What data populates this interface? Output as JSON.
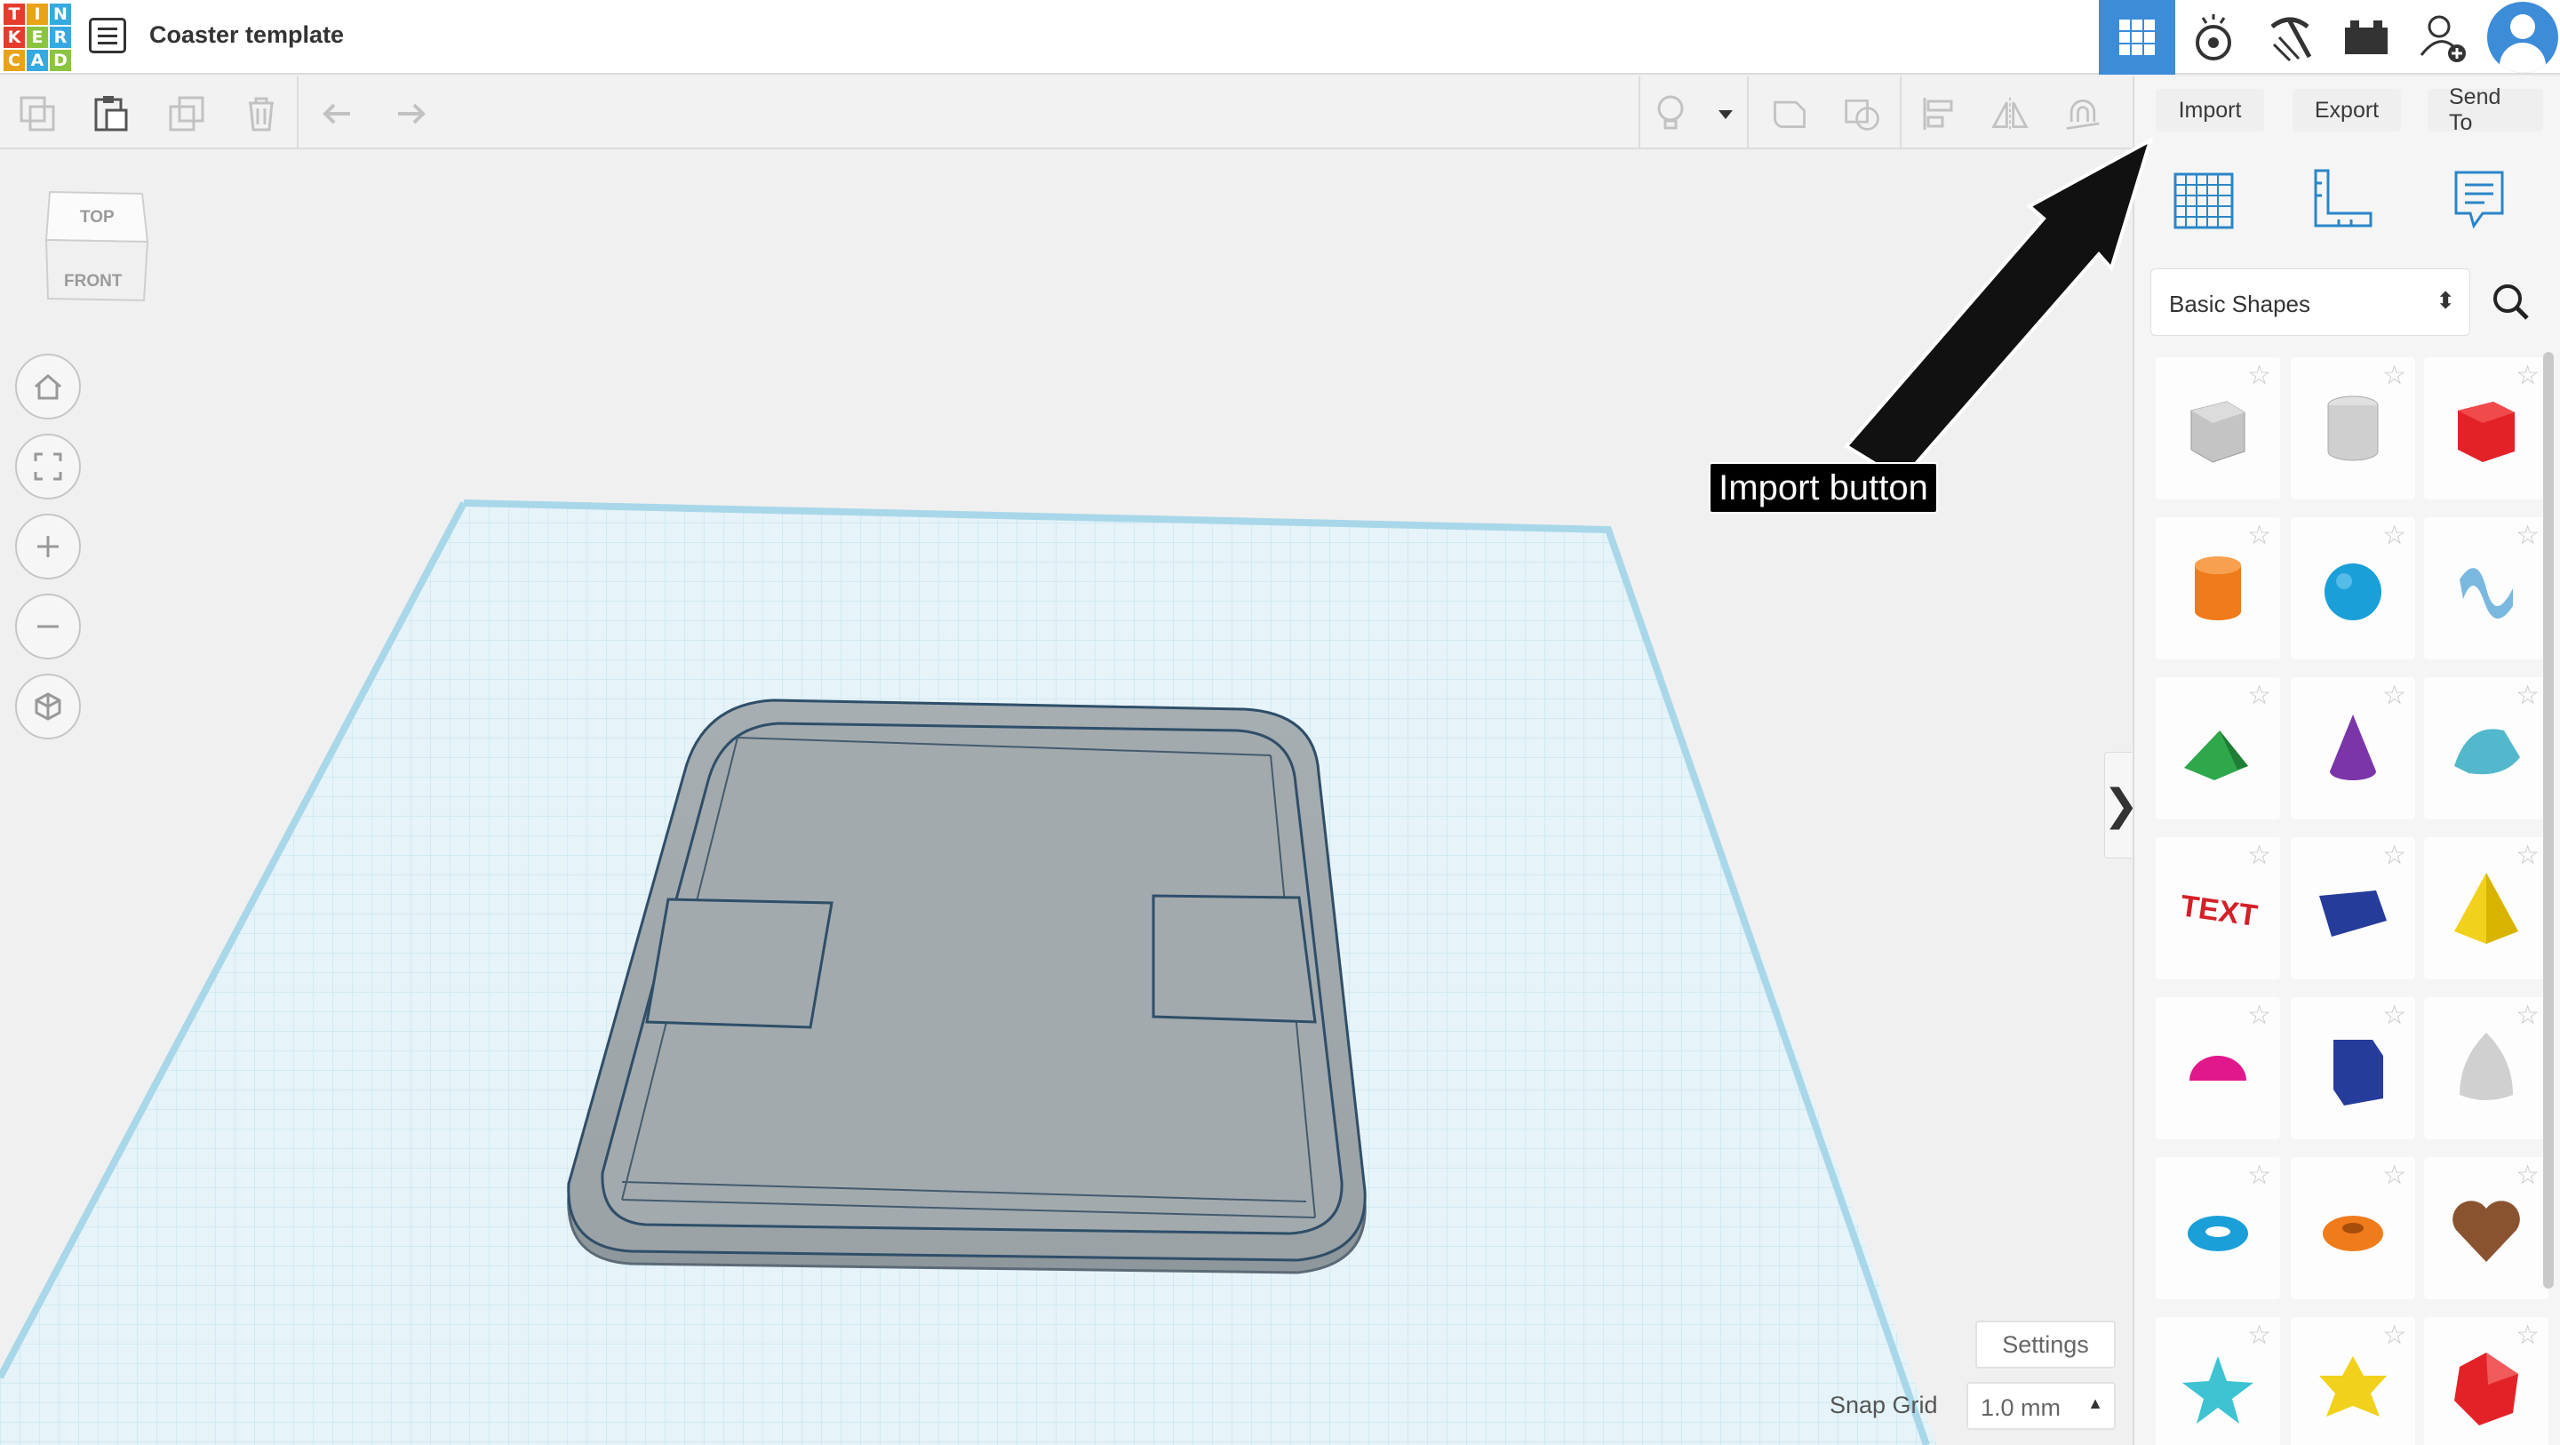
{
  "app": {
    "logo_letters": [
      "T",
      "I",
      "N",
      "K",
      "E",
      "R",
      "C",
      "A",
      "D"
    ],
    "logo_colors": [
      "#e53c2e",
      "#e8a317",
      "#36a9e1",
      "#e53c2e",
      "#8bc53f",
      "#36a9e1",
      "#e8a317",
      "#36a9e1",
      "#8bc53f"
    ],
    "document_title": "Coaster template",
    "accent_color": "#3c8cd8"
  },
  "header_icons": [
    "3d-design-grid-icon",
    "circuits-icon",
    "blocks-pickaxe-icon",
    "bricks-icon",
    "add-user-icon",
    "user-avatar-icon"
  ],
  "toolbar": {
    "icons": [
      "copy-icon",
      "paste-icon",
      "duplicate-icon",
      "delete-icon",
      "undo-icon",
      "redo-icon",
      "light-bulb-icon",
      "dropdown-icon",
      "group-icon",
      "ungroup-icon",
      "align-icon",
      "mirror-icon",
      "workplane-magnet-icon"
    ]
  },
  "panel": {
    "tabs": [
      "Import",
      "Export",
      "Send To"
    ],
    "view_icons": [
      "workplane-grid-icon",
      "ruler-icon",
      "notes-icon"
    ],
    "library_select": "Basic Shapes",
    "shapes": [
      {
        "name": "Box (hole)",
        "color": "#bdbdbd"
      },
      {
        "name": "Cylinder (hole)",
        "color": "#c8c8c8"
      },
      {
        "name": "Box",
        "color": "#e32228"
      },
      {
        "name": "Cylinder",
        "color": "#f07b1b"
      },
      {
        "name": "Sphere",
        "color": "#1a9fd8"
      },
      {
        "name": "Scribble",
        "color": "#7ab8e0"
      },
      {
        "name": "Roof",
        "color": "#2ea84a"
      },
      {
        "name": "Cone",
        "color": "#7b35a8"
      },
      {
        "name": "Round Roof",
        "color": "#53b8cc"
      },
      {
        "name": "Text",
        "color": "#d42027"
      },
      {
        "name": "Wedge",
        "color": "#253c9a"
      },
      {
        "name": "Pyramid",
        "color": "#f2d11c"
      },
      {
        "name": "Half Sphere",
        "color": "#e0188c"
      },
      {
        "name": "Polygon",
        "color": "#253c9a"
      },
      {
        "name": "Paraboloid",
        "color": "#d0d0d0"
      },
      {
        "name": "Torus",
        "color": "#1a9fd8"
      },
      {
        "name": "Tube",
        "color": "#f07b1b"
      },
      {
        "name": "Heart",
        "color": "#8a5330"
      },
      {
        "name": "Star",
        "color": "#3dc3d2"
      },
      {
        "name": "Star Six",
        "color": "#f2d11c"
      },
      {
        "name": "Icosahedron",
        "color": "#e32228"
      }
    ]
  },
  "view_cube": {
    "top_label": "TOP",
    "front_label": "FRONT"
  },
  "nav_buttons": [
    "home-icon",
    "fit-view-icon",
    "zoom-in-icon",
    "zoom-out-icon",
    "ortho-view-icon"
  ],
  "bottom": {
    "settings_label": "Settings",
    "snap_grid_label": "Snap Grid",
    "snap_grid_value": "1.0 mm"
  },
  "annotation": {
    "callout_text": "Import button"
  }
}
